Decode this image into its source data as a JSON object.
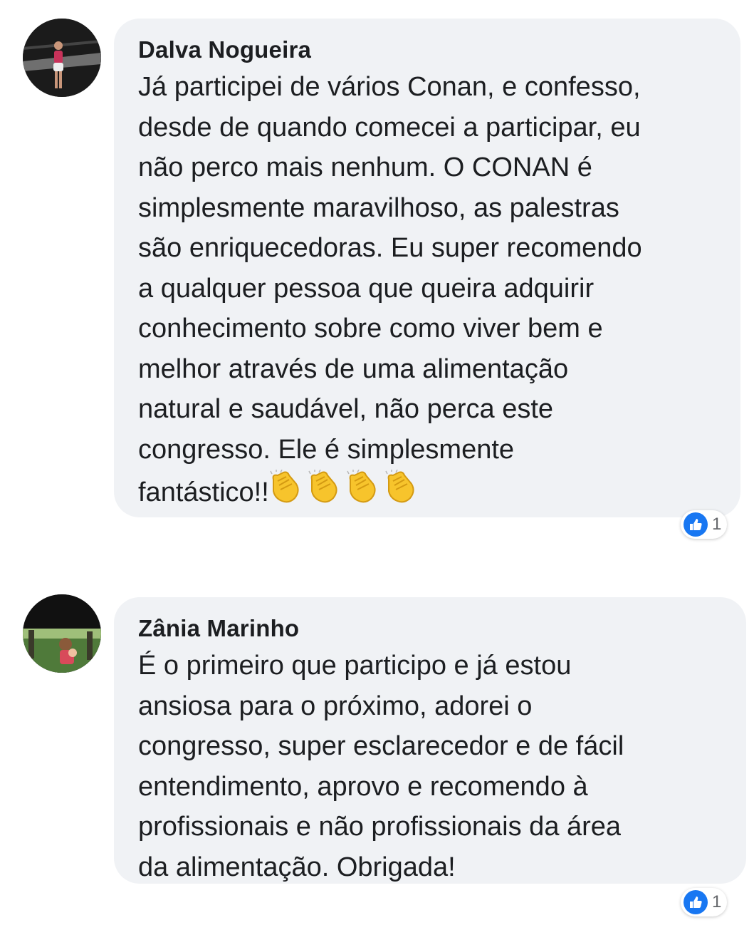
{
  "comments": [
    {
      "author": "Dalva Nogueira",
      "text": "Já participei de vários Conan, e confesso,\ndesde de quando comecei a participar, eu\nnão perco mais nenhum. O CONAN é\nsimplesmente maravilhoso, as palestras\nsão enriquecedoras. Eu super recomendo\na qualquer pessoa que queira adquirir\nconhecimento sobre como viver bem e\nmelhor através de uma alimentação\nnatural e saudável, não perca este\ncongresso. Ele é simplesmente\nfantástico!!",
      "emoji": "clapping-hands x4",
      "like_count": "1"
    },
    {
      "author": "Zânia Marinho",
      "text": "É o primeiro que participo e já estou\nansiosa para o próximo, adorei o\ncongresso, super esclarecedor e de fácil\nentendimento, aprovo e recomendo à\nprofissionais e não profissionais da área\nda alimentação. Obrigada!",
      "like_count": "1"
    }
  ],
  "colors": {
    "bubble": "#f0f2f5",
    "like_badge": "#1877f2",
    "text": "#1c1e21"
  }
}
